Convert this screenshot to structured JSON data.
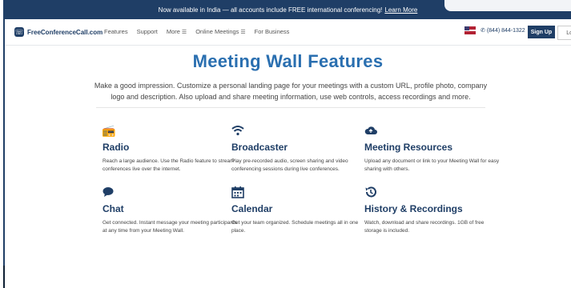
{
  "banner": {
    "text": "Now available in India — all accounts include FREE international conferencing!",
    "link": "Learn More"
  },
  "nav": {
    "logo_text": "FreeConferenceCall.com",
    "links": [
      "Features",
      "Support",
      "More",
      "Online Meetings",
      "For Business"
    ],
    "phone": "(844) 844-1322",
    "signup": "Sign Up",
    "login": "Log In"
  },
  "main": {
    "title": "Meeting Wall Features",
    "description": "Make a good impression. Customize a personal landing page for your meetings with a custom URL, profile photo, company logo and description. Also upload and share meeting information, use web controls, access recordings and more."
  },
  "features": [
    {
      "icon": "radio-icon",
      "title": "Radio",
      "text": "Reach a large audience. Use the Radio feature to stream conferences live over the internet."
    },
    {
      "icon": "wifi-icon",
      "title": "Broadcaster",
      "text": "Play pre-recorded audio, screen sharing and video conferencing sessions during live conferences."
    },
    {
      "icon": "cloud-upload-icon",
      "title": "Meeting Resources",
      "text": "Upload any document or link to your Meeting Wall for easy sharing with others."
    },
    {
      "icon": "chat-icon",
      "title": "Chat",
      "text": "Get connected. Instant message your meeting participants at any time from your Meeting Wall."
    },
    {
      "icon": "calendar-icon",
      "title": "Calendar",
      "text": "Get your team organized. Schedule meetings all in one place."
    },
    {
      "icon": "history-icon",
      "title": "History & Recordings",
      "text": "Watch, download and share recordings. 1GB of free storage is included."
    }
  ],
  "colors": {
    "primary": "#1f3e66",
    "title": "#2a6fb0"
  }
}
